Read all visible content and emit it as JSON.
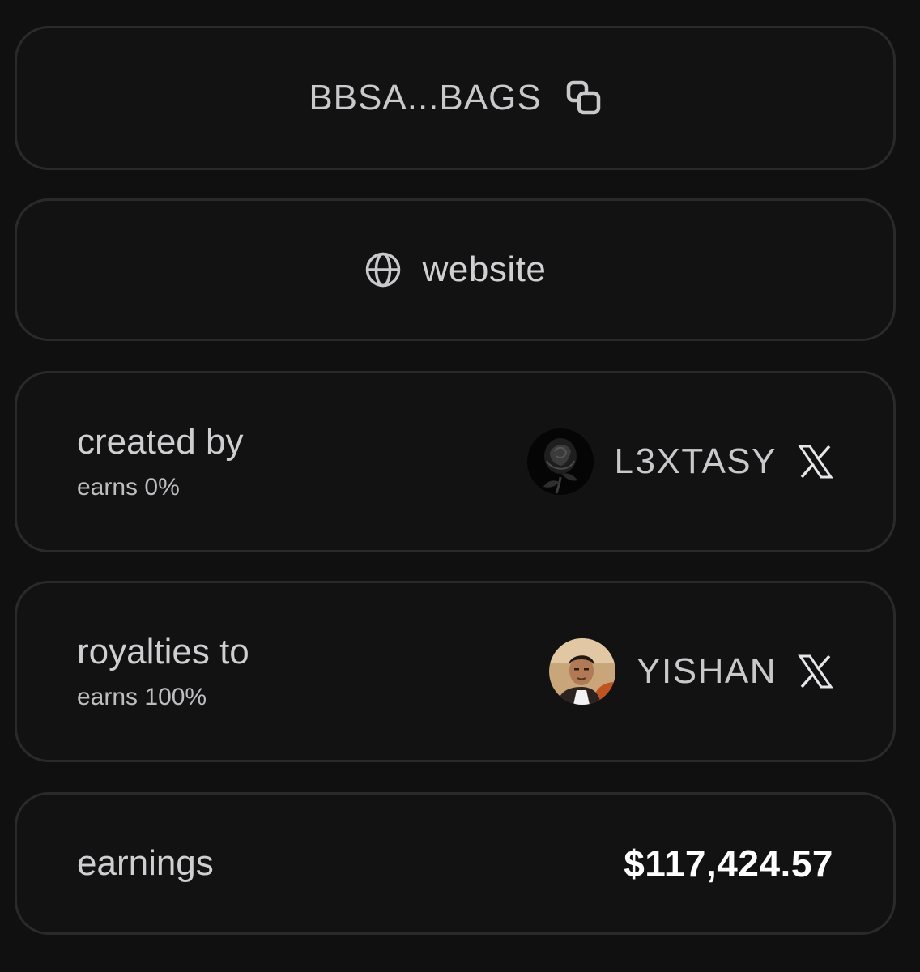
{
  "address": {
    "text": "BBSA...BAGS",
    "icon": "copy-icon"
  },
  "website": {
    "label": "website",
    "icon": "globe-icon"
  },
  "creator": {
    "title": "created by",
    "subtitle": "earns 0%",
    "handle": "L3XTASY",
    "avatar": "rose-avatar",
    "social_icon": "x-icon"
  },
  "royalties": {
    "title": "royalties to",
    "subtitle": "earns 100%",
    "handle": "YISHAN",
    "avatar": "person-avatar",
    "social_icon": "x-icon"
  },
  "earnings": {
    "label": "earnings",
    "amount": "$117,424.57"
  },
  "colors": {
    "background": "#101011",
    "card": "#121213",
    "border": "#2a2a2c",
    "text": "#cfcfd1",
    "amount": "#ffffff"
  }
}
